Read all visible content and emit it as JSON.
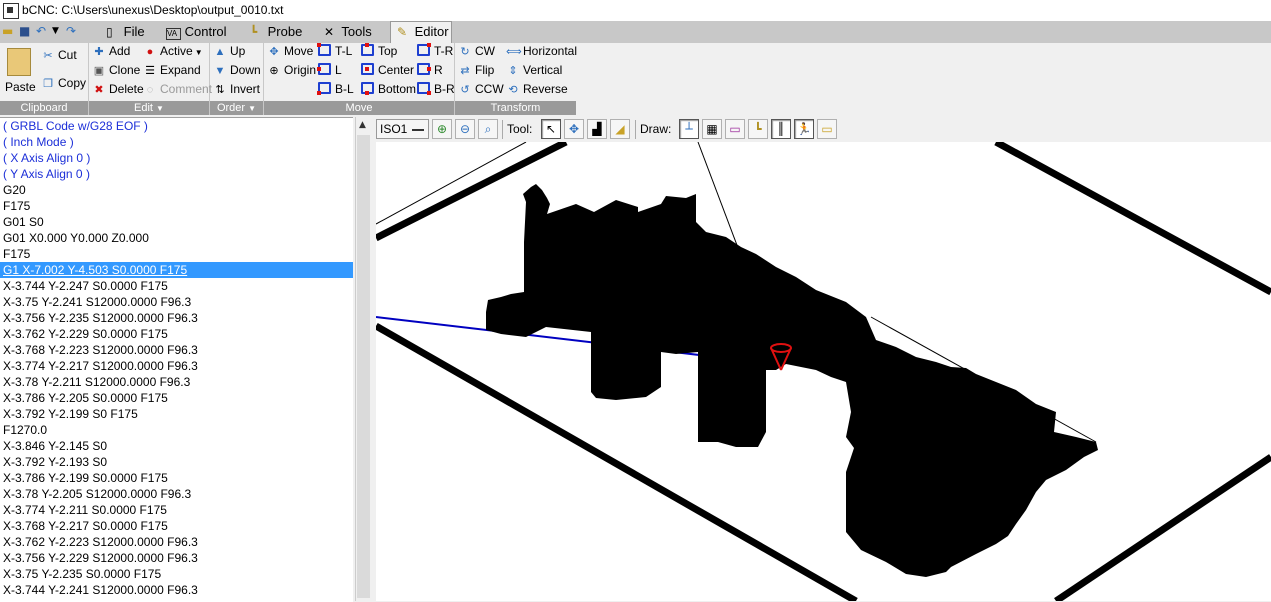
{
  "window": {
    "title": "bCNC: C:\\Users\\unexus\\Desktop\\output_0010.txt",
    "app_icon": "printer-icon"
  },
  "tabs": [
    {
      "label": "File",
      "icon": "document-icon"
    },
    {
      "label": "Control",
      "icon": "vac-icon"
    },
    {
      "label": "Probe",
      "icon": "probe-icon"
    },
    {
      "label": "Tools",
      "icon": "wrench-icon"
    },
    {
      "label": "Editor",
      "icon": "editor-icon",
      "active": true
    }
  ],
  "ribbon": {
    "clipboard": {
      "label": "Clipboard",
      "paste": "Paste",
      "cut": "Cut",
      "copy": "Copy"
    },
    "edit": {
      "label": "Edit",
      "add": "Add",
      "clone": "Clone",
      "delete": "Delete",
      "active": "Active",
      "expand": "Expand",
      "comment": "Comment"
    },
    "order": {
      "label": "Order",
      "up": "Up",
      "down": "Down",
      "invert": "Invert"
    },
    "move": {
      "label": "Move",
      "move": "Move",
      "origin": "Origin",
      "tl": "T-L",
      "l": "L",
      "bl": "B-L",
      "top": "Top",
      "center": "Center",
      "bottom": "Bottom",
      "tr": "T-R",
      "r": "R",
      "br": "B-R"
    },
    "transform": {
      "label": "Transform",
      "cw": "CW",
      "flip": "Flip",
      "ccw": "CCW",
      "horizontal": "Horizontal",
      "vertical": "Vertical",
      "reverse": "Reverse"
    }
  },
  "canvas_toolbar": {
    "view": "ISO1",
    "tool_label": "Tool:",
    "draw_label": "Draw:"
  },
  "gcode": [
    {
      "text": "( GRBL Code w/G28 EOF  )",
      "type": "comment"
    },
    {
      "text": "( Inch Mode  )",
      "type": "comment"
    },
    {
      "text": "( X Axis Align  0 )",
      "type": "comment"
    },
    {
      "text": "( Y Axis Align  0 )",
      "type": "comment"
    },
    {
      "text": "G20",
      "type": "code"
    },
    {
      "text": "F175",
      "type": "code"
    },
    {
      "text": "G01 S0",
      "type": "code"
    },
    {
      "text": "G01 X0.000 Y0.000 Z0.000",
      "type": "code"
    },
    {
      "text": "F175",
      "type": "code"
    },
    {
      "text": "G1 X-7.002 Y-4.503 S0.0000 F175",
      "type": "selected"
    },
    {
      "text": "X-3.744 Y-2.247 S0.0000 F175",
      "type": "code"
    },
    {
      "text": "X-3.75 Y-2.241 S12000.0000 F96.3",
      "type": "code"
    },
    {
      "text": "X-3.756 Y-2.235 S12000.0000 F96.3",
      "type": "code"
    },
    {
      "text": "X-3.762 Y-2.229 S0.0000 F175",
      "type": "code"
    },
    {
      "text": "X-3.768 Y-2.223 S12000.0000 F96.3",
      "type": "code"
    },
    {
      "text": "X-3.774 Y-2.217 S12000.0000 F96.3",
      "type": "code"
    },
    {
      "text": "X-3.78 Y-2.211 S12000.0000 F96.3",
      "type": "code"
    },
    {
      "text": "X-3.786 Y-2.205 S0.0000 F175",
      "type": "code"
    },
    {
      "text": "X-3.792 Y-2.199 S0 F175",
      "type": "code"
    },
    {
      "text": "F1270.0",
      "type": "code"
    },
    {
      "text": "X-3.846 Y-2.145 S0",
      "type": "code"
    },
    {
      "text": "X-3.792 Y-2.193 S0",
      "type": "code"
    },
    {
      "text": "X-3.786 Y-2.199 S0.0000 F175",
      "type": "code"
    },
    {
      "text": "X-3.78 Y-2.205 S12000.0000 F96.3",
      "type": "code"
    },
    {
      "text": "X-3.774 Y-2.211 S0.0000 F175",
      "type": "code"
    },
    {
      "text": "X-3.768 Y-2.217 S0.0000 F175",
      "type": "code"
    },
    {
      "text": "X-3.762 Y-2.223 S12000.0000 F96.3",
      "type": "code"
    },
    {
      "text": "X-3.756 Y-2.229 S12000.0000 F96.3",
      "type": "code"
    },
    {
      "text": "X-3.75 Y-2.235 S0.0000 F175",
      "type": "code"
    },
    {
      "text": "X-3.744 Y-2.241 S12000.0000 F96.3",
      "type": "code"
    }
  ],
  "colors": {
    "selection": "#3399ff",
    "comment": "#1c2fd8",
    "group_label_bg": "#9a9a9a",
    "toolpath": "#000000",
    "rapid_move": "#0000c0",
    "tool_marker": "#e01010"
  }
}
